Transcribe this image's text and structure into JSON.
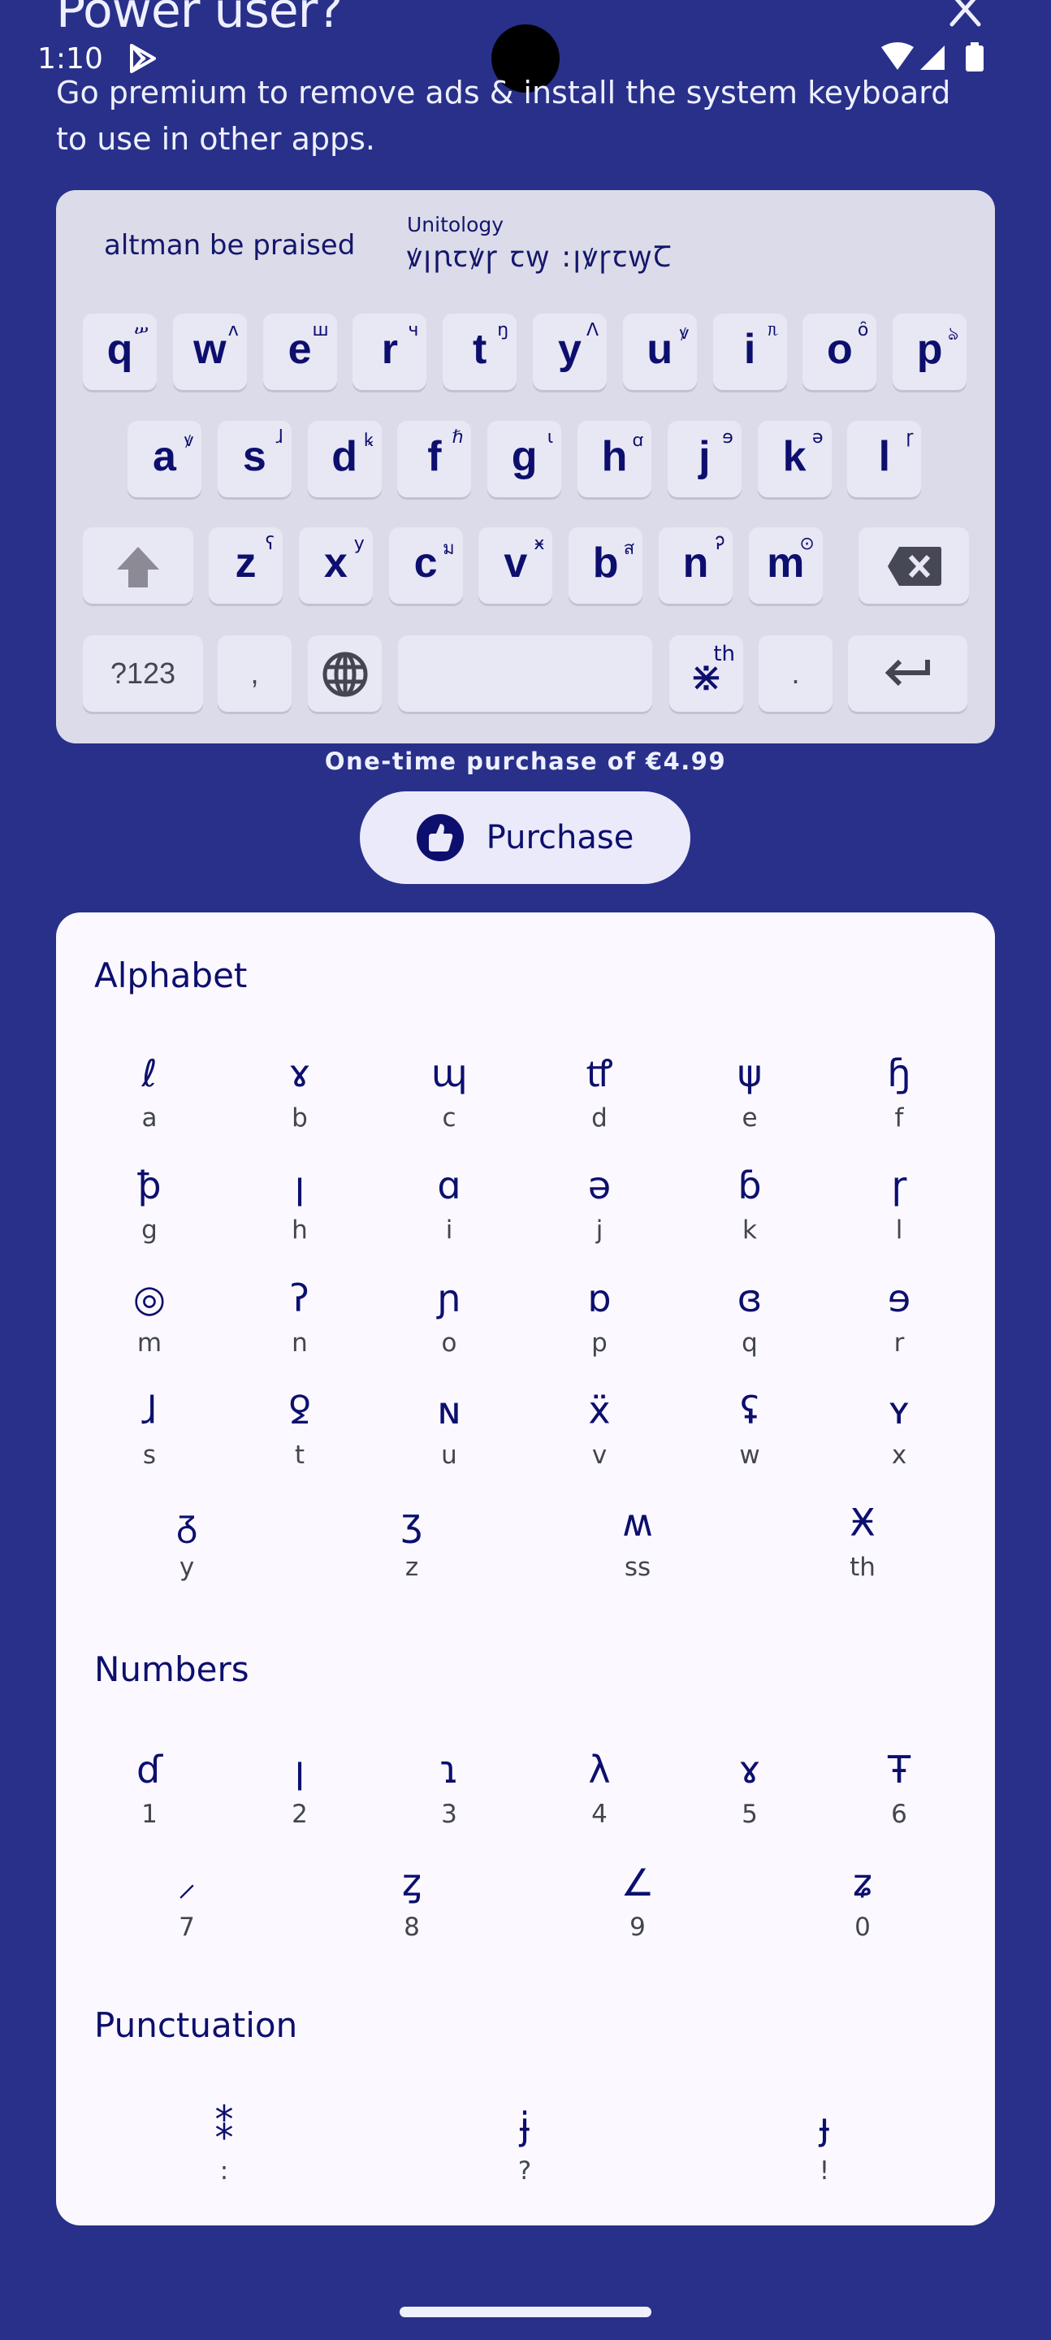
{
  "header": {
    "title": "Power user?",
    "subtitle": "Go premium to remove ads & install the system keyboard to use in other apps."
  },
  "status_bar": {
    "time": "1:10"
  },
  "keyboard_preview": {
    "typed_text": "altman be praised",
    "language_label": "Unitology",
    "transliteration": "ꝟꞁꞃꞇꝟꞅ ꞇꝡ ꞉ꞁꝟꞅꞇꝡꞆ",
    "rows": [
      [
        {
          "key": "q",
          "alt": "ሠ"
        },
        {
          "key": "w",
          "alt": "ʌ"
        },
        {
          "key": "e",
          "alt": "ш"
        },
        {
          "key": "r",
          "alt": "ч"
        },
        {
          "key": "t",
          "alt": "ŋ"
        },
        {
          "key": "y",
          "alt": "ꓥ"
        },
        {
          "key": "u",
          "alt": "ꝟ"
        },
        {
          "key": "i",
          "alt": "ᥰ"
        },
        {
          "key": "o",
          "alt": "ȏ"
        },
        {
          "key": "p",
          "alt": "ঌ"
        }
      ],
      [
        {
          "key": "a",
          "alt": "ꝟ"
        },
        {
          "key": "s",
          "alt": "ɺ"
        },
        {
          "key": "d",
          "alt": "ꝃ"
        },
        {
          "key": "f",
          "alt": "ℏ"
        },
        {
          "key": "g",
          "alt": "ɩ"
        },
        {
          "key": "h",
          "alt": "ꭤ"
        },
        {
          "key": "j",
          "alt": "ɘ"
        },
        {
          "key": "k",
          "alt": "ə"
        },
        {
          "key": "l",
          "alt": "ɼ"
        }
      ],
      [
        {
          "key": "z",
          "alt": "ʕ"
        },
        {
          "key": "x",
          "alt": "y"
        },
        {
          "key": "c",
          "alt": "ม"
        },
        {
          "key": "v",
          "alt": "ӿ"
        },
        {
          "key": "b",
          "alt": "ส"
        },
        {
          "key": "n",
          "alt": "Ꭾ"
        },
        {
          "key": "m",
          "alt": "⊙"
        }
      ]
    ],
    "numbers_key": "?123",
    "comma_key": ",",
    "period_key": ".",
    "special_key": "⋇",
    "special_key_alt": "th"
  },
  "purchase": {
    "price_text": "One-time purchase of €4.99",
    "button_label": "Purchase"
  },
  "sections": {
    "alphabet": {
      "title": "Alphabet",
      "items": [
        {
          "glyph": "ℓ",
          "latin": "a"
        },
        {
          "glyph": "ɤ",
          "latin": "b"
        },
        {
          "glyph": "ɰ",
          "latin": "c"
        },
        {
          "glyph": "ꝷ",
          "latin": "d"
        },
        {
          "glyph": "ψ",
          "latin": "e"
        },
        {
          "glyph": "ɧ",
          "latin": "f"
        },
        {
          "glyph": "ꝥ",
          "latin": "g"
        },
        {
          "glyph": "ꞁ",
          "latin": "h"
        },
        {
          "glyph": "ɑ",
          "latin": "i"
        },
        {
          "glyph": "ə",
          "latin": "j"
        },
        {
          "glyph": "ɓ",
          "latin": "k"
        },
        {
          "glyph": "ɼ",
          "latin": "l"
        },
        {
          "glyph": "◎",
          "latin": "m"
        },
        {
          "glyph": "ʔ",
          "latin": "n"
        },
        {
          "glyph": "ɲ",
          "latin": "o"
        },
        {
          "glyph": "ɒ",
          "latin": "p"
        },
        {
          "glyph": "ɞ",
          "latin": "q"
        },
        {
          "glyph": "ɘ",
          "latin": "r"
        },
        {
          "glyph": "ɺ",
          "latin": "s"
        },
        {
          "glyph": "ꝿ",
          "latin": "t"
        },
        {
          "glyph": "ɴ",
          "latin": "u"
        },
        {
          "glyph": "ẍ",
          "latin": "v"
        },
        {
          "glyph": "ʢ",
          "latin": "w"
        },
        {
          "glyph": "ʏ",
          "latin": "x"
        }
      ],
      "last_row": [
        {
          "glyph": "ᵹ",
          "latin": "y"
        },
        {
          "glyph": "ʒ",
          "latin": "z"
        },
        {
          "glyph": "ʍ",
          "latin": "ss"
        },
        {
          "glyph": "Ӿ",
          "latin": "th"
        }
      ]
    },
    "numbers": {
      "title": "Numbers",
      "items": [
        {
          "glyph": "ɗ",
          "latin": "1"
        },
        {
          "glyph": "ꞁ",
          "latin": "2"
        },
        {
          "glyph": "ɿ",
          "latin": "3"
        },
        {
          "glyph": "λ",
          "latin": "4"
        },
        {
          "glyph": "ɤ",
          "latin": "5"
        },
        {
          "glyph": "Ŧ",
          "latin": "6"
        }
      ],
      "last_row": [
        {
          "glyph": "⸝",
          "latin": "7"
        },
        {
          "glyph": "ȥ",
          "latin": "8"
        },
        {
          "glyph": "∠",
          "latin": "9"
        },
        {
          "glyph": "ʑ",
          "latin": "0"
        }
      ]
    },
    "punctuation": {
      "title": "Punctuation",
      "items": [
        {
          "glyph": "⁑",
          "latin": ":"
        },
        {
          "glyph": "ɉ",
          "latin": "?"
        },
        {
          "glyph": "ɟ",
          "latin": "!"
        }
      ]
    }
  },
  "colors": {
    "background": "#29308a",
    "keyboard_bg": "#dcdbe9",
    "key_bg": "#e8e7f4",
    "accent_text": "#0d0f6e",
    "card_bg": "#fbf9ff"
  }
}
